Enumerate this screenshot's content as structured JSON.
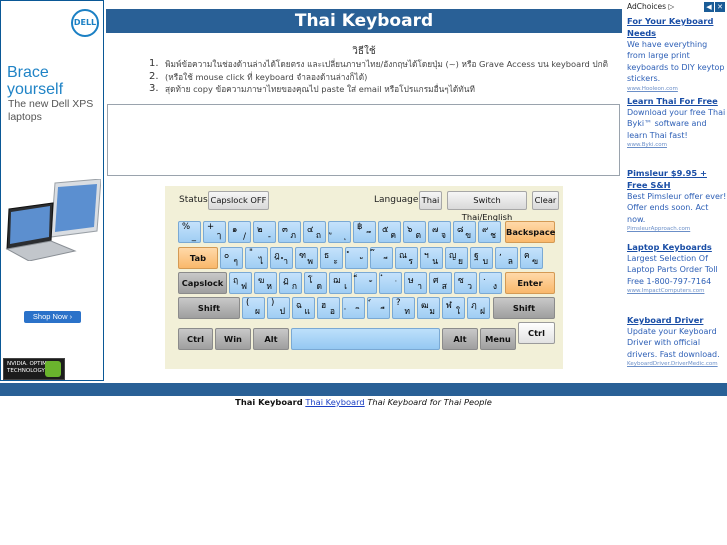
{
  "left_ad": {
    "brand": "DELL",
    "headline": "Brace yourself",
    "subline": "The new Dell XPS laptops",
    "cta": "Shop Now ›",
    "badge": "NVIDIA. OPTIMUS TECHNOLOGY"
  },
  "page": {
    "title": "Thai Keyboard",
    "how_to": "วิธีใช้",
    "instructions": [
      {
        "num": "1.",
        "text": "พิมพ์ข้อความในช่องด้านล่างได้โดยตรง และเปลี่ยนภาษาไทย/อังกฤษได้โดยปุ่ม (~) หรือ Grave Access บน keyboard ปกติ"
      },
      {
        "num": "2.",
        "text": "(หรือใช้ mouse click ที่ keyboard จำลองด้านล่างก็ได้)"
      },
      {
        "num": "3.",
        "text": "สุดท้าย copy ข้อความภาษาไทยของคุณไป paste ใส่ email หรือโปรแกรมอื่นๆได้ทันที"
      }
    ],
    "text_area_value": ""
  },
  "toolbar": {
    "status_label": "Status",
    "capslock_btn": "Capslock OFF",
    "language_label": "Language",
    "language_btn": "Thai",
    "switch_btn": "Switch Thai/English",
    "clear_btn": "Clear"
  },
  "keyboard": {
    "row1": [
      {
        "tl": "%",
        "br": "_"
      },
      {
        "tl": "+",
        "br": "ๅ"
      },
      {
        "tl": "๑",
        "br": "/"
      },
      {
        "tl": "๒",
        "br": "-"
      },
      {
        "tl": "๓",
        "br": "ภ"
      },
      {
        "tl": "๔",
        "br": "ถ"
      },
      {
        "tl": "ู",
        "br": "ุ"
      },
      {
        "tl": "฿",
        "br": "ึ"
      },
      {
        "tl": "๕",
        "br": "ค"
      },
      {
        "tl": "๖",
        "br": "ต"
      },
      {
        "tl": "๗",
        "br": "จ"
      },
      {
        "tl": "๘",
        "br": "ข"
      },
      {
        "tl": "๙",
        "br": "ช"
      }
    ],
    "row2": [
      {
        "tl": "๐",
        "br": "ๆ"
      },
      {
        "tl": "\"",
        "br": "ไ"
      },
      {
        "tl": "ฎ",
        "br": "ำ"
      },
      {
        "tl": "ฑ",
        "br": "พ"
      },
      {
        "tl": "ธ",
        "br": "ะ"
      },
      {
        "tl": "ํ",
        "br": "ั"
      },
      {
        "tl": "๊",
        "br": "ี"
      },
      {
        "tl": "ณ",
        "br": "ร"
      },
      {
        "tl": "ฯ",
        "br": "น"
      },
      {
        "tl": "ญ",
        "br": "ย"
      },
      {
        "tl": "ฐ",
        "br": "บ"
      },
      {
        "tl": ",",
        "br": "ล"
      },
      {
        "tl": "ฅ",
        "br": "ฃ"
      }
    ],
    "row3": [
      {
        "tl": "ฤ",
        "br": "ฟ"
      },
      {
        "tl": "ฆ",
        "br": "ห"
      },
      {
        "tl": "ฏ",
        "br": "ก"
      },
      {
        "tl": "โ",
        "br": "ด"
      },
      {
        "tl": "ฌ",
        "br": "เ"
      },
      {
        "tl": "็",
        "br": "้"
      },
      {
        "tl": "๋",
        "br": "่"
      },
      {
        "tl": "ษ",
        "br": "า"
      },
      {
        "tl": "ศ",
        "br": "ส"
      },
      {
        "tl": "ซ",
        "br": "ว"
      },
      {
        "tl": ".",
        "br": "ง"
      }
    ],
    "row4": [
      {
        "tl": "(",
        "br": "ผ"
      },
      {
        "tl": ")",
        "br": "ป"
      },
      {
        "tl": "ฉ",
        "br": "แ"
      },
      {
        "tl": "ฮ",
        "br": "อ"
      },
      {
        "tl": "ฺ",
        "br": "ิ"
      },
      {
        "tl": "์",
        "br": "ื"
      },
      {
        "tl": "?",
        "br": "ท"
      },
      {
        "tl": "ฒ",
        "br": "ม"
      },
      {
        "tl": "ฬ",
        "br": "ใ"
      },
      {
        "tl": "ฦ",
        "br": "ฝ"
      }
    ],
    "special": {
      "backspace": "Backspace",
      "tab": "Tab",
      "capslock": "Capslock",
      "enter": "Enter",
      "shift_left": "Shift",
      "shift_right": "Shift",
      "ctrl_left": "Ctrl",
      "win": "Win",
      "alt_left": "Alt",
      "alt_right": "Alt",
      "menu": "Menu",
      "ctrl_right": "Ctrl"
    }
  },
  "right_ads": {
    "adchoices": "AdChoices ▷",
    "items": [
      {
        "title": "For Your Keyboard Needs",
        "desc": "We have everything from large print keyboards to DIY keytop stickers.",
        "url": "www.Hooleon.com"
      },
      {
        "title": "Learn Thai For Free",
        "desc": "Download your free Thai Byki™ software and learn Thai fast!",
        "url": "www.Byki.com"
      },
      {
        "title": "Pimsleur $9.95 + Free S&H",
        "desc": "Best Pimsleur offer ever! Offer ends soon. Act now.",
        "url": "PimsleurApproach.com"
      },
      {
        "title": "Laptop Keyboards",
        "desc": "Largest Selection Of Laptop Parts Order Toll Free 1-800-797-7164",
        "url": "www.ImpactComputers.com"
      },
      {
        "title": "Keyboard Driver",
        "desc": "Update your Keyboard Driver with official drivers. Fast download.",
        "url": "KeyboardDriver.DriverMedic.com"
      }
    ]
  },
  "footer": {
    "bold": "Thai Keyboard",
    "link": "Thai Keyboard",
    "italic": "Thai Keyboard for Thai People"
  }
}
